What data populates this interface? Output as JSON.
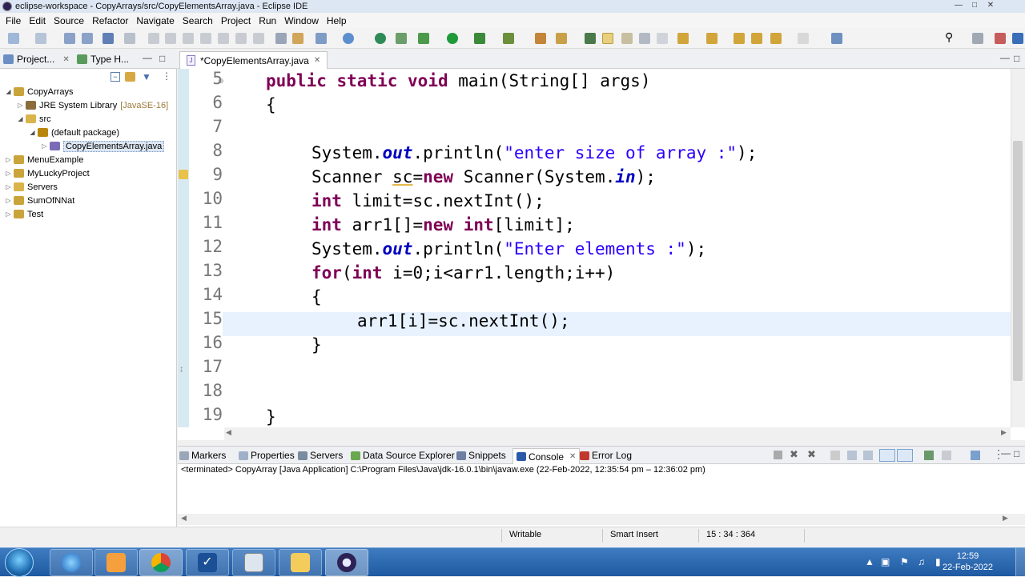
{
  "window": {
    "title": "eclipse-workspace - CopyArrays/src/CopyElementsArray.java - Eclipse IDE"
  },
  "menu": [
    "File",
    "Edit",
    "Source",
    "Refactor",
    "Navigate",
    "Search",
    "Project",
    "Run",
    "Window",
    "Help"
  ],
  "left_panel": {
    "tabs": [
      {
        "label": "Project..."
      },
      {
        "label": "Type H..."
      }
    ],
    "tree": [
      {
        "label": "CopyArrays",
        "indent": 0,
        "twist": "◢",
        "icon": "project-icon",
        "color": "#c9a43a"
      },
      {
        "label": "JRE System Library",
        "suffix": "[JavaSE-16]",
        "indent": 1,
        "twist": "▷",
        "icon": "library-icon",
        "color": "#8a6d3b"
      },
      {
        "label": "src",
        "indent": 1,
        "twist": "◢",
        "icon": "folder-icon",
        "color": "#d9b44a"
      },
      {
        "label": "(default package)",
        "indent": 2,
        "twist": "◢",
        "icon": "package-icon",
        "color": "#b8860b"
      },
      {
        "label": "CopyElementsArray.java",
        "indent": 3,
        "twist": "▷",
        "icon": "java-file-icon",
        "color": "#7b6ab8",
        "selected": true
      },
      {
        "label": "MenuExample",
        "indent": 0,
        "twist": "▷",
        "icon": "project-icon",
        "color": "#c9a43a"
      },
      {
        "label": "MyLuckyProject",
        "indent": 0,
        "twist": "▷",
        "icon": "project-icon",
        "color": "#c9a43a"
      },
      {
        "label": "Servers",
        "indent": 0,
        "twist": "▷",
        "icon": "folder-icon",
        "color": "#d9b44a"
      },
      {
        "label": "SumOfNNat",
        "indent": 0,
        "twist": "▷",
        "icon": "project-icon",
        "color": "#c9a43a"
      },
      {
        "label": "Test",
        "indent": 0,
        "twist": "▷",
        "icon": "project-icon",
        "color": "#c9a43a"
      }
    ]
  },
  "editor": {
    "tab_label": "*CopyElementsArray.java",
    "line_numbers": [
      "5",
      "6",
      "7",
      "8",
      "9",
      "10",
      "11",
      "12",
      "13",
      "14",
      "15",
      "16",
      "17",
      "18",
      "19"
    ],
    "current_line": "15"
  },
  "bottom_panel": {
    "tabs": [
      {
        "label": "Markers",
        "icon": "markers-icon",
        "color": "#9aa7b8"
      },
      {
        "label": "Properties",
        "icon": "properties-icon",
        "color": "#9fb0c8"
      },
      {
        "label": "Servers",
        "icon": "servers-icon",
        "color": "#7a8aa0"
      },
      {
        "label": "Data Source Explorer",
        "icon": "data-source-icon",
        "color": "#6aa84f"
      },
      {
        "label": "Snippets",
        "icon": "snippets-icon",
        "color": "#6d7fa3"
      },
      {
        "label": "Console",
        "icon": "console-icon",
        "color": "#2b5aa7",
        "active": true
      },
      {
        "label": "Error Log",
        "icon": "error-log-icon",
        "color": "#c0392b"
      }
    ],
    "console_text": "<terminated> CopyArray [Java Application] C:\\Program Files\\Java\\jdk-16.0.1\\bin\\javaw.exe  (22-Feb-2022, 12:35:54 pm – 12:36:02 pm)"
  },
  "status": {
    "writable": "Writable",
    "insert_mode": "Smart Insert",
    "position": "15 : 34 : 364"
  },
  "taskbar": {
    "time": "12:59",
    "date": "22-Feb-2022"
  }
}
